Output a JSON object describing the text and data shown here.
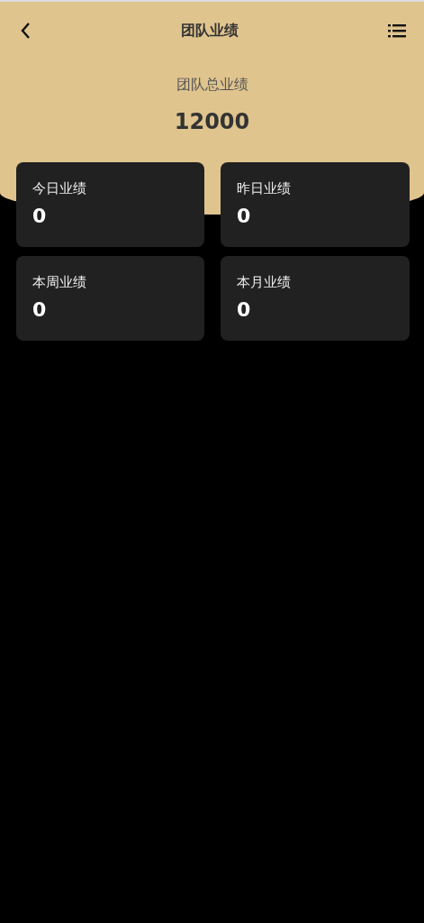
{
  "nav_bar": {
    "title": "团队业绩"
  },
  "total": {
    "label": "团队总业绩",
    "value": "12000"
  },
  "stats": [
    {
      "label": "今日业绩",
      "value": "0"
    },
    {
      "label": "昨日业绩",
      "value": "0"
    },
    {
      "label": "本周业绩",
      "value": "0"
    },
    {
      "label": "本月业绩",
      "value": "0"
    }
  ]
}
